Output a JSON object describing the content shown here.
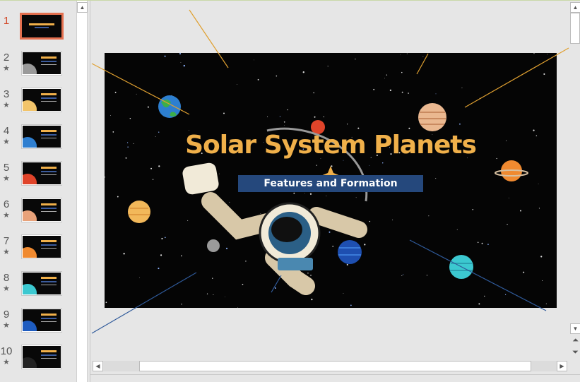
{
  "slide_panel": {
    "slides": [
      {
        "number": "1",
        "selected": true,
        "animated": false
      },
      {
        "number": "2",
        "selected": false,
        "animated": true,
        "planet_color": "#9a9a9a"
      },
      {
        "number": "3",
        "selected": false,
        "animated": true,
        "planet_color": "#f2c46a"
      },
      {
        "number": "4",
        "selected": false,
        "animated": true,
        "planet_color": "#2f7fd0"
      },
      {
        "number": "5",
        "selected": false,
        "animated": true,
        "planet_color": "#e0442a"
      },
      {
        "number": "6",
        "selected": false,
        "animated": true,
        "planet_color": "#e8a27a"
      },
      {
        "number": "7",
        "selected": false,
        "animated": true,
        "planet_color": "#f08a30"
      },
      {
        "number": "8",
        "selected": false,
        "animated": true,
        "planet_color": "#3cc8d0"
      },
      {
        "number": "9",
        "selected": false,
        "animated": true,
        "planet_color": "#1e5cc0"
      },
      {
        "number": "10",
        "selected": false,
        "animated": true,
        "planet_color": "#222222"
      }
    ],
    "star_glyph": "★"
  },
  "slide": {
    "title": "Solar System Planets",
    "subtitle": "Features and Formation"
  },
  "colors": {
    "accent": "#e4704f",
    "title": "#f0b04a",
    "subtitle_bar": "#25487c"
  },
  "scroll": {
    "up": "▲",
    "down": "▼",
    "left": "◀",
    "right": "▶",
    "prev_slide": "⏶",
    "next_slide": "⏷"
  }
}
